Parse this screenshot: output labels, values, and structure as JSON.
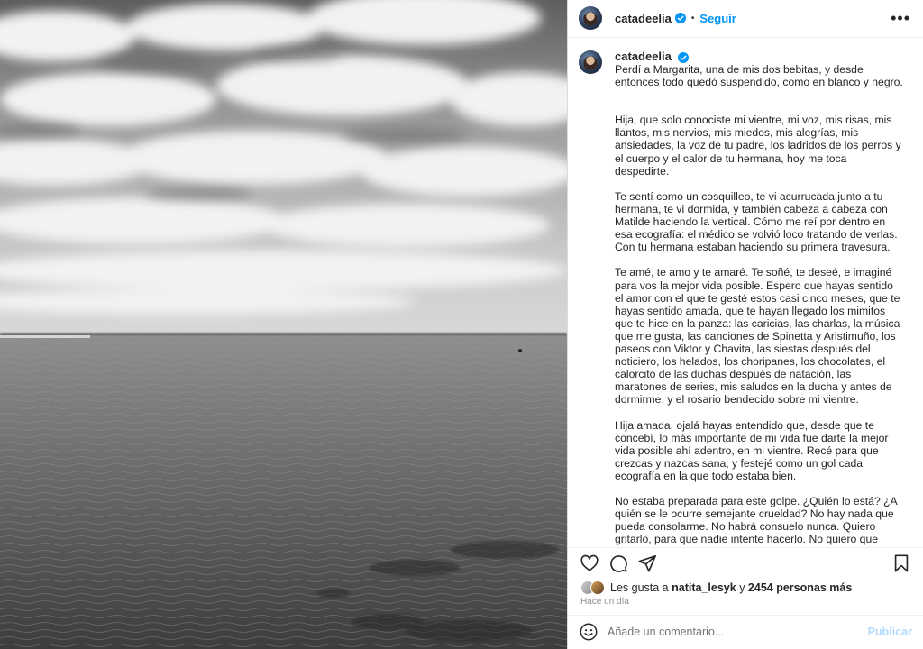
{
  "post": {
    "username": "catadeelia",
    "follow_label": "Seguir",
    "separator": "•",
    "more_label": "•••",
    "caption_paragraphs": [
      "Perdí a Margarita, una de mis dos bebitas, y desde entonces todo quedó suspendido, como en blanco y negro.",
      "Hija, que solo conociste mi vientre, mi voz, mis risas, mis llantos, mis nervios, mis miedos, mis alegrías, mis ansiedades, la voz de tu padre, los ladridos de los perros y el cuerpo y el calor de tu hermana, hoy me toca despedirte.",
      "Te sentí como un cosquilleo, te vi acurrucada junto a tu hermana, te vi dormida, y también cabeza a cabeza con Matilde haciendo la vertical. Cómo me reí por dentro en esa ecografía: el médico se volvió loco tratando de verlas. Con tu hermana estaban haciendo su primera travesura.",
      "Te amé, te amo y te amaré. Te soñé, te deseé, e imaginé para vos la mejor vida posible. Espero que hayas sentido el amor con el que te gesté estos casi cinco meses, que te hayas sentido amada, que te hayan llegado los mimitos que te hice en la panza: las caricias, las charlas, la música que me gusta, las canciones de Spinetta y Aristimuño, los paseos con Viktor y Chavita, las siestas después del noticiero, los helados, los choripanes, los chocolates, el calorcito de las duchas después de natación, las maratones de series, mis saludos en la ducha y antes de dormirme, y el rosario bendecido sobre mi vientre.",
      "Hija amada, ojalá hayas entendido que, desde que te concebí, lo más importante de mi vida fue darte la mejor vida posible ahí adentro, en mi vientre. Recé para que crezcas y nazcas sana, y festejé como un gol cada ecografía en la que todo estaba bien.",
      "No estaba preparada para este golpe. ¿Quién lo está? ¿A quién se le ocurre semejante crueldad? No hay nada que pueda consolarme. No habrá consuelo nunca. Quiero gritarlo, para que nadie intente hacerlo. No quiero que nadie me pregunte, que nadie me diga nada. Es imposible. La vida me separa de vos y ahora solo pienso en cómo se vive con esto."
    ],
    "likes": {
      "prefix": "Les gusta a",
      "user": "natita_lesyk",
      "connector": "y",
      "count_text": "2454 personas más"
    },
    "time_ago": "Hace un día",
    "comment": {
      "placeholder": "Añade un comentario...",
      "publish_label": "Publicar"
    }
  },
  "colors": {
    "accent": "#0095f6",
    "publish_disabled": "#b3dbff",
    "text": "#262626",
    "muted": "#8e8e8e",
    "border": "#dbdbdb"
  },
  "icons": [
    "verified-badge-icon",
    "more-options-icon",
    "heart-icon",
    "comment-icon",
    "share-icon",
    "bookmark-icon",
    "emoji-icon"
  ]
}
